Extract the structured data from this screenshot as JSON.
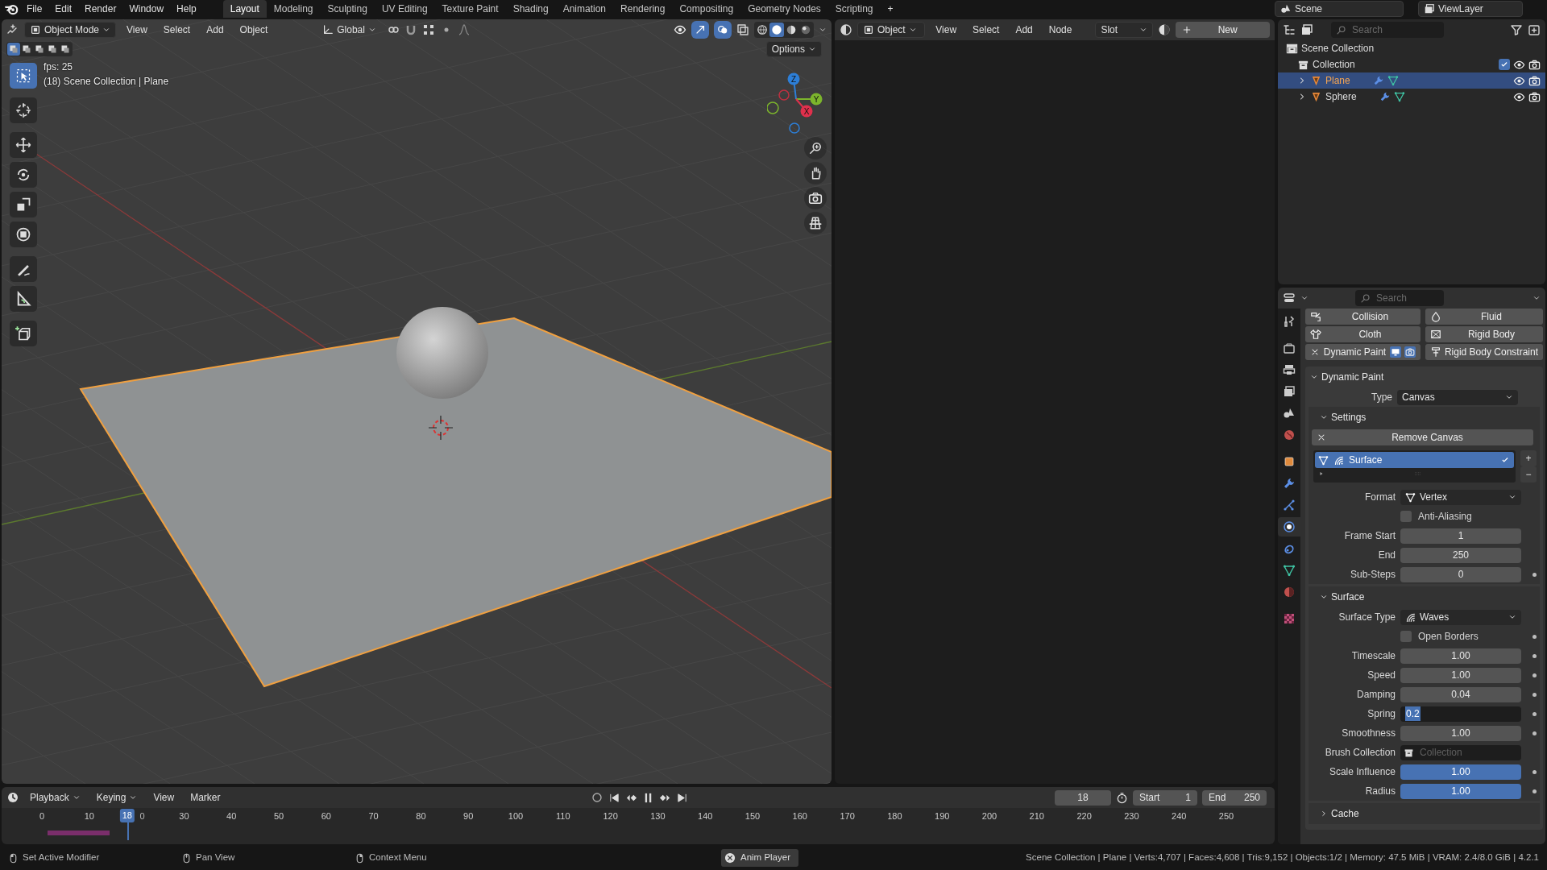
{
  "menubar": {
    "menus": [
      "File",
      "Edit",
      "Render",
      "Window",
      "Help"
    ],
    "workspaces": [
      {
        "label": "Layout",
        "selected": true
      },
      {
        "label": "Modeling",
        "selected": false
      },
      {
        "label": "Sculpting",
        "selected": false
      },
      {
        "label": "UV Editing",
        "selected": false
      },
      {
        "label": "Texture Paint",
        "selected": false
      },
      {
        "label": "Shading",
        "selected": false
      },
      {
        "label": "Animation",
        "selected": false
      },
      {
        "label": "Rendering",
        "selected": false
      },
      {
        "label": "Compositing",
        "selected": false
      },
      {
        "label": "Geometry Nodes",
        "selected": false
      },
      {
        "label": "Scripting",
        "selected": false
      }
    ],
    "add_workspace": "+",
    "scene": "Scene",
    "view_layer": "ViewLayer"
  },
  "viewport": {
    "mode": "Object Mode",
    "menus": [
      "View",
      "Select",
      "Add",
      "Object"
    ],
    "orientation": "Global",
    "shading_modes": [
      {
        "kind": "wireframe",
        "selected": false
      },
      {
        "kind": "solid",
        "selected": true
      },
      {
        "kind": "material",
        "selected": false
      },
      {
        "kind": "rendered",
        "selected": false
      }
    ],
    "select_modes": [
      {
        "selected": true
      },
      {
        "selected": false
      },
      {
        "selected": false
      },
      {
        "selected": false
      },
      {
        "selected": false
      }
    ],
    "options": "Options",
    "overlay_lines": [
      "fps: 25",
      "(18) Scene Collection | Plane"
    ],
    "gizmo_axes": [
      "Z",
      "Y",
      "X"
    ],
    "tools": [
      {
        "kind": "select",
        "selected": true
      },
      {
        "kind": "cursor",
        "selected": false
      },
      {
        "kind": "move",
        "selected": false
      },
      {
        "kind": "rotate",
        "selected": false
      },
      {
        "kind": "scale",
        "selected": false
      },
      {
        "kind": "transform",
        "selected": false
      },
      {
        "kind": "annotate",
        "selected": false
      },
      {
        "kind": "measure",
        "selected": false
      },
      {
        "kind": "add_cube",
        "selected": false
      }
    ]
  },
  "shader_editor": {
    "object": "Object",
    "menus": [
      "View",
      "Select",
      "Add",
      "Node"
    ],
    "slot": "Slot",
    "new_button": "New"
  },
  "outliner": {
    "search_placeholder": "Search",
    "items": [
      {
        "label": "Scene Collection",
        "kind": "scene_collection",
        "selected": false,
        "children": [
          {
            "label": "Collection",
            "kind": "collection",
            "selected": false,
            "checked": true,
            "children": [
              {
                "label": "Plane",
                "kind": "object",
                "selected": true,
                "expanded": false
              },
              {
                "label": "Sphere",
                "kind": "object",
                "selected": false,
                "expanded": false
              }
            ]
          }
        ]
      }
    ]
  },
  "properties": {
    "search_placeholder": "Search",
    "tabs": [
      {
        "kind": "tool",
        "selected": false
      },
      {
        "kind": "render",
        "selected": false
      },
      {
        "kind": "output",
        "selected": false
      },
      {
        "kind": "view_layer",
        "selected": false
      },
      {
        "kind": "scene",
        "selected": false
      },
      {
        "kind": "world",
        "selected": false
      },
      {
        "kind": "object",
        "selected": false
      },
      {
        "kind": "modifiers",
        "selected": false
      },
      {
        "kind": "particles",
        "selected": false
      },
      {
        "kind": "physics",
        "selected": true
      },
      {
        "kind": "constraints",
        "selected": false
      },
      {
        "kind": "data",
        "selected": false
      },
      {
        "kind": "material",
        "selected": false
      },
      {
        "kind": "texture",
        "selected": false
      }
    ],
    "physics_buttons": [
      {
        "label": "Collision",
        "kind": "collision",
        "enabled": false
      },
      {
        "label": "Fluid",
        "kind": "fluid",
        "enabled": false
      },
      {
        "label": "Cloth",
        "kind": "cloth",
        "enabled": false
      },
      {
        "label": "Rigid Body",
        "kind": "rigid_body",
        "enabled": false
      },
      {
        "label": "Dynamic Paint",
        "kind": "dynamic_paint",
        "enabled": true
      },
      {
        "label": "Rigid Body Constraint",
        "kind": "rigid_body_constraint",
        "enabled": false
      }
    ],
    "panel": {
      "title": "Dynamic Paint",
      "expanded": true,
      "rows": [
        {
          "kind": "dropdown",
          "label": "Type",
          "value": "Canvas"
        }
      ],
      "subpanels": [
        {
          "title": "Settings",
          "expanded": true,
          "rows": [
            {
              "kind": "button",
              "label": "Remove Canvas"
            },
            {
              "kind": "list",
              "items": [
                {
                  "label": "Surface",
                  "selected": true,
                  "checked": true
                }
              ],
              "add": "+",
              "remove": "−"
            },
            {
              "kind": "format_dropdown",
              "label": "Format",
              "value": "Vertex"
            },
            {
              "kind": "checkbox",
              "label": "Anti-Aliasing",
              "checked": false,
              "animatable": false
            },
            {
              "kind": "number",
              "label": "Frame Start",
              "value": "1",
              "animatable": false,
              "highlighted": false,
              "editing": false
            },
            {
              "kind": "number",
              "label": "End",
              "value": "250",
              "animatable": false,
              "highlighted": false,
              "editing": false
            },
            {
              "kind": "number",
              "label": "Sub-Steps",
              "value": "0",
              "animatable": true,
              "highlighted": false,
              "editing": false
            }
          ]
        },
        {
          "title": "Surface",
          "expanded": true,
          "rows": [
            {
              "kind": "surface_type_dropdown",
              "label": "Surface Type",
              "value": "Waves"
            },
            {
              "kind": "checkbox",
              "label": "Open Borders",
              "checked": false,
              "animatable": true
            },
            {
              "kind": "number",
              "label": "Timescale",
              "value": "1.00",
              "animatable": true,
              "highlighted": false,
              "editing": false
            },
            {
              "kind": "number",
              "label": "Speed",
              "value": "1.00",
              "animatable": true,
              "highlighted": false,
              "editing": false
            },
            {
              "kind": "number",
              "label": "Damping",
              "value": "0.04",
              "animatable": true,
              "highlighted": false,
              "editing": false
            },
            {
              "kind": "number",
              "label": "Spring",
              "value": "0.2",
              "animatable": true,
              "highlighted": false,
              "editing": true
            },
            {
              "kind": "number",
              "label": "Smoothness",
              "value": "1.00",
              "animatable": true,
              "highlighted": false,
              "editing": false
            },
            {
              "kind": "object_field",
              "label": "Brush Collection",
              "placeholder": "Collection"
            },
            {
              "kind": "number",
              "label": "Scale Influence",
              "value": "1.00",
              "animatable": true,
              "highlighted": true,
              "editing": false
            },
            {
              "kind": "number",
              "label": "Radius",
              "value": "1.00",
              "animatable": true,
              "highlighted": true,
              "editing": false
            }
          ]
        },
        {
          "title": "Cache",
          "expanded": false
        }
      ]
    }
  },
  "timeline": {
    "menus": [
      "Playback",
      "Keying",
      "View",
      "Marker"
    ],
    "current_frame": "18",
    "start_label": "Start",
    "start": "1",
    "end_label": "End",
    "end": "250",
    "ticks": [
      {
        "label": "0",
        "partial": false
      },
      {
        "label": "10",
        "partial": false
      },
      {
        "label": "0",
        "partial": true
      },
      {
        "label": "30",
        "partial": false
      },
      {
        "label": "40",
        "partial": false
      },
      {
        "label": "50",
        "partial": false
      },
      {
        "label": "60",
        "partial": false
      },
      {
        "label": "70",
        "partial": false
      },
      {
        "label": "80",
        "partial": false
      },
      {
        "label": "90",
        "partial": false
      },
      {
        "label": "100",
        "partial": false
      },
      {
        "label": "110",
        "partial": false
      },
      {
        "label": "120",
        "partial": false
      },
      {
        "label": "130",
        "partial": false
      },
      {
        "label": "140",
        "partial": false
      },
      {
        "label": "150",
        "partial": false
      },
      {
        "label": "160",
        "partial": false
      },
      {
        "label": "170",
        "partial": false
      },
      {
        "label": "180",
        "partial": false
      },
      {
        "label": "190",
        "partial": false
      },
      {
        "label": "200",
        "partial": false
      },
      {
        "label": "210",
        "partial": false
      },
      {
        "label": "220",
        "partial": false
      },
      {
        "label": "230",
        "partial": false
      },
      {
        "label": "240",
        "partial": false
      },
      {
        "label": "250",
        "partial": false
      }
    ],
    "playhead": {
      "label": "18",
      "level": 0.072
    }
  },
  "status_bar": {
    "hints": [
      {
        "label": "Set Active Modifier",
        "kind": "mouse_left"
      },
      {
        "label": "Pan View",
        "kind": "mouse_middle"
      },
      {
        "label": "Context Menu",
        "kind": "mouse_right"
      }
    ],
    "job": "Anim Player",
    "stats": "Scene Collection | Plane | Verts:4,707 | Faces:4,608 | Tris:9,152 | Objects:1/2 | Memory: 47.5 MiB | VRAM: 2.4/8.0 GiB | 4.2.1"
  }
}
